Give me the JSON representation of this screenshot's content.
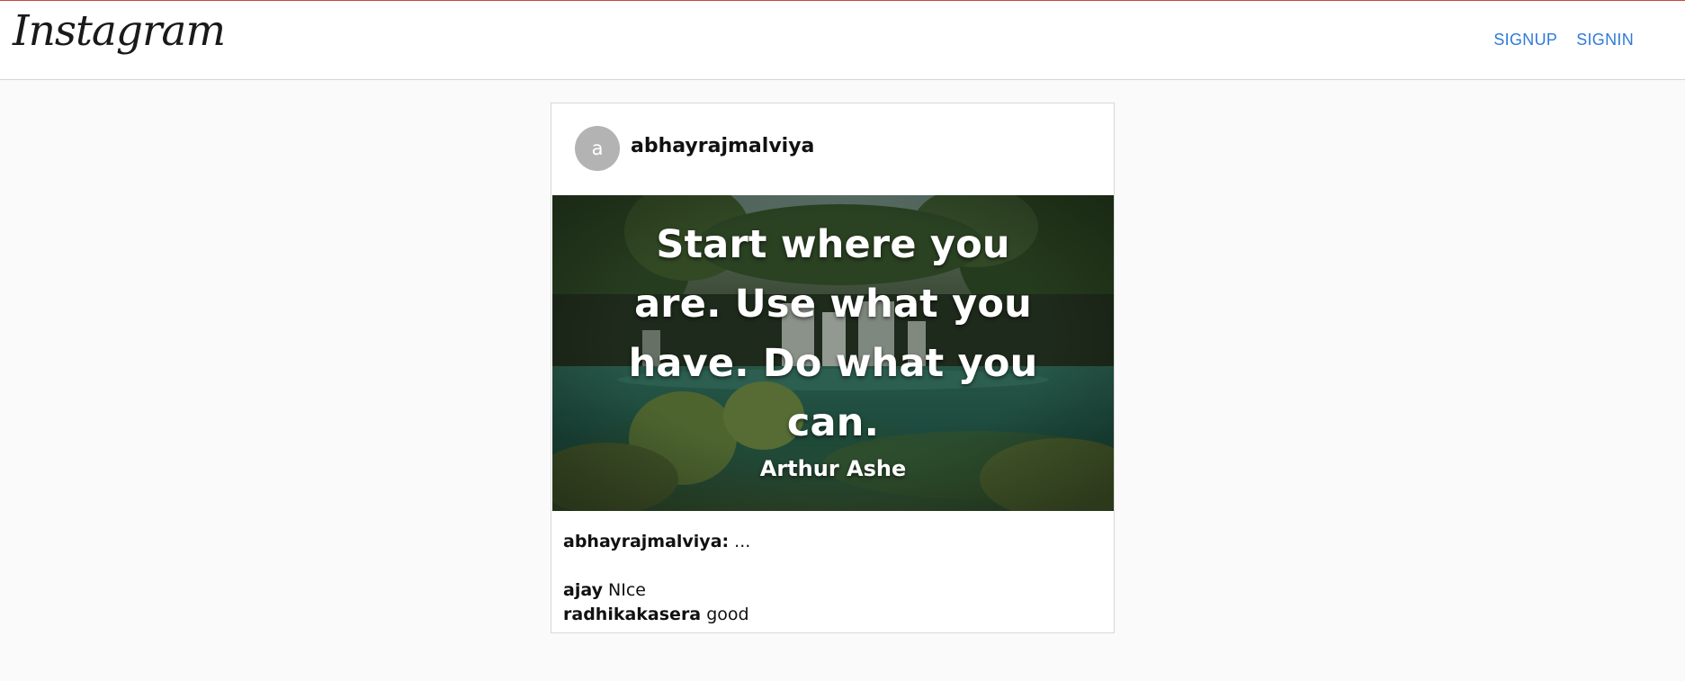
{
  "app": {
    "logo_text": "Instagram"
  },
  "nav": {
    "signup_label": "SIGNUP",
    "signin_label": "SIGNIN"
  },
  "post": {
    "avatar_letter": "a",
    "username": "abhayrajmalviya",
    "image": {
      "quote_lines": [
        "Start where you",
        "are. Use what you",
        "have. Do what you",
        "can."
      ],
      "author": "Arthur Ashe"
    },
    "caption": {
      "username": "abhayrajmalviya:",
      "text": "..."
    },
    "comments": [
      {
        "username": "ajay",
        "text": "NIce"
      },
      {
        "username": "radhikakasera",
        "text": "good"
      }
    ]
  },
  "colors": {
    "link": "#2f7bd8",
    "avatar_bg": "#b3b3b3",
    "page_bg": "#fafafa",
    "top_accent": "#c9473f"
  }
}
